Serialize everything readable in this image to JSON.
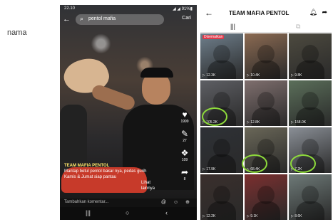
{
  "side_label": "nama",
  "left_phone": {
    "status_time": "22.10",
    "status_right": "◢ ◢ 91%▮",
    "search_query": "pentol mafia",
    "cart_label": "Cari",
    "actions": [
      {
        "icon": "♥",
        "count": "1999",
        "name": "like-icon"
      },
      {
        "icon": "✎",
        "count": "27",
        "name": "comment-icon"
      },
      {
        "icon": "❖",
        "count": "109",
        "name": "save-icon"
      },
      {
        "icon": "➦",
        "count": "8",
        "name": "share-icon"
      }
    ],
    "caption": {
      "username": "TEAM MAFIA PENTOL",
      "line1": "Mantap betul pentol bakar nya, pedas gurih",
      "line2": "Kamis & Jumat siap pantau",
      "more": "Lihat lainnya"
    },
    "comment_placeholder": "Tambahkan komentar...",
    "comment_icons": "@ ☺ ⊕",
    "nav": [
      "|||",
      "○",
      "‹"
    ]
  },
  "right_phone": {
    "title": "TEAM MAFIA PENTOL",
    "tabs": [
      "|||",
      "⧉"
    ],
    "videos": [
      {
        "views": "▷ 12.3K",
        "pinned": "Disematkan",
        "color": "#6f7f8c"
      },
      {
        "views": "▷ 10.4K",
        "pinned": "",
        "color": "#8b6a52"
      },
      {
        "views": "▷ 9.8K",
        "pinned": "",
        "color": "#4d4a3f"
      },
      {
        "views": "▷ 105.2K",
        "pinned": "",
        "color": "#5e5f64"
      },
      {
        "views": "▷ 12.8K",
        "pinned": "",
        "color": "#7f6f6e"
      },
      {
        "views": "▷ 158.0K",
        "pinned": "",
        "color": "#5b6f5a"
      },
      {
        "views": "▷ 17.9K",
        "pinned": "",
        "color": "#2e3136"
      },
      {
        "views": "▷ 68.4K",
        "pinned": "",
        "color": "#6a6758"
      },
      {
        "views": "▷ 7.2K",
        "pinned": "",
        "color": "#8a8f96"
      },
      {
        "views": "▷ 12.2K",
        "pinned": "",
        "color": "#3a2f2c"
      },
      {
        "views": "▷ 9.1K",
        "pinned": "",
        "color": "#7c2f2f"
      },
      {
        "views": "▷ 8.6K",
        "pinned": "",
        "color": "#6e7a78"
      }
    ]
  }
}
